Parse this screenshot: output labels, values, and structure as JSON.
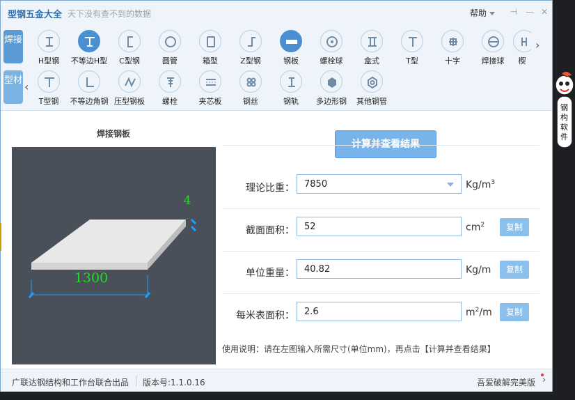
{
  "window": {
    "title": "型钢五金大全",
    "slogan": "天下没有查不到的数据",
    "help_label": "帮助",
    "pin_glyph": "⊣",
    "min_glyph": "—",
    "close_glyph": "✕"
  },
  "side_tabs": {
    "weld": "焊接",
    "profile": "型材"
  },
  "toolbar": {
    "row1_next": "›",
    "row2_prev": "‹",
    "row1": [
      {
        "label": "H型钢",
        "icon": "h-beam-icon"
      },
      {
        "label": "不等边H型",
        "icon": "unequal-h-beam-icon",
        "selected": true
      },
      {
        "label": "C型钢",
        "icon": "c-channel-icon"
      },
      {
        "label": "圆管",
        "icon": "round-pipe-icon"
      },
      {
        "label": "箱型",
        "icon": "box-section-icon"
      },
      {
        "label": "Z型钢",
        "icon": "z-section-icon"
      },
      {
        "label": "钢板",
        "icon": "steel-plate-icon",
        "selected": true
      },
      {
        "label": "螺栓球",
        "icon": "bolt-ball-icon"
      },
      {
        "label": "盒式",
        "icon": "box-type-icon"
      },
      {
        "label": "T型",
        "icon": "t-section-icon"
      },
      {
        "label": "十字",
        "icon": "cross-section-icon"
      },
      {
        "label": "焊接球",
        "icon": "welded-ball-icon"
      },
      {
        "label": "楔",
        "icon": "wedge-icon"
      }
    ],
    "row2": [
      {
        "label": "T型钢",
        "icon": "t-steel-icon"
      },
      {
        "label": "不等边角钢",
        "icon": "unequal-angle-icon"
      },
      {
        "label": "压型钢板",
        "icon": "profiled-sheet-icon"
      },
      {
        "label": "螺栓",
        "icon": "bolt-icon"
      },
      {
        "label": "夹芯板",
        "icon": "sandwich-panel-icon"
      },
      {
        "label": "钢丝",
        "icon": "steel-wire-icon"
      },
      {
        "label": "钢轨",
        "icon": "rail-icon"
      },
      {
        "label": "多边形钢",
        "icon": "polygon-steel-icon"
      },
      {
        "label": "其他钢管",
        "icon": "other-pipe-icon"
      }
    ]
  },
  "diagram": {
    "title": "焊接钢板",
    "thickness": "4",
    "width": "1300",
    "colors": {
      "background": "#4a5059",
      "dimension_text": "#22dd22",
      "dimension_line": "#1aa0ff",
      "plate": "#e8e8e8"
    }
  },
  "calc_button": "计算并查看结果",
  "fields": [
    {
      "label": "理论比重：",
      "value": "7850",
      "unit": "Kg/m",
      "unit_sup": "3",
      "has_dropdown": true,
      "has_copy": false
    },
    {
      "label": "截面面积：",
      "value": "52",
      "unit": "cm",
      "unit_sup": "2",
      "has_dropdown": false,
      "has_copy": true
    },
    {
      "label": "单位重量：",
      "value": "40.82",
      "unit": "Kg/m",
      "unit_sup": "",
      "has_dropdown": false,
      "has_copy": true
    },
    {
      "label": "每米表面积：",
      "value": "2.6",
      "unit": "m",
      "unit_sup": "2",
      "unit_suffix": "/m",
      "has_dropdown": false,
      "has_copy": true
    }
  ],
  "copy_label": "复制",
  "usage": "使用说明：请在左图输入所需尺寸(单位mm)，再点击【计算并查看结果】",
  "status": {
    "credit": "广联达钢结构和工作台联合出品",
    "version": "版本号:1.1.0.16",
    "crack_label": "吾爱破解完美版",
    "chevron": "›"
  },
  "mascot": {
    "text": "钢构软件"
  }
}
